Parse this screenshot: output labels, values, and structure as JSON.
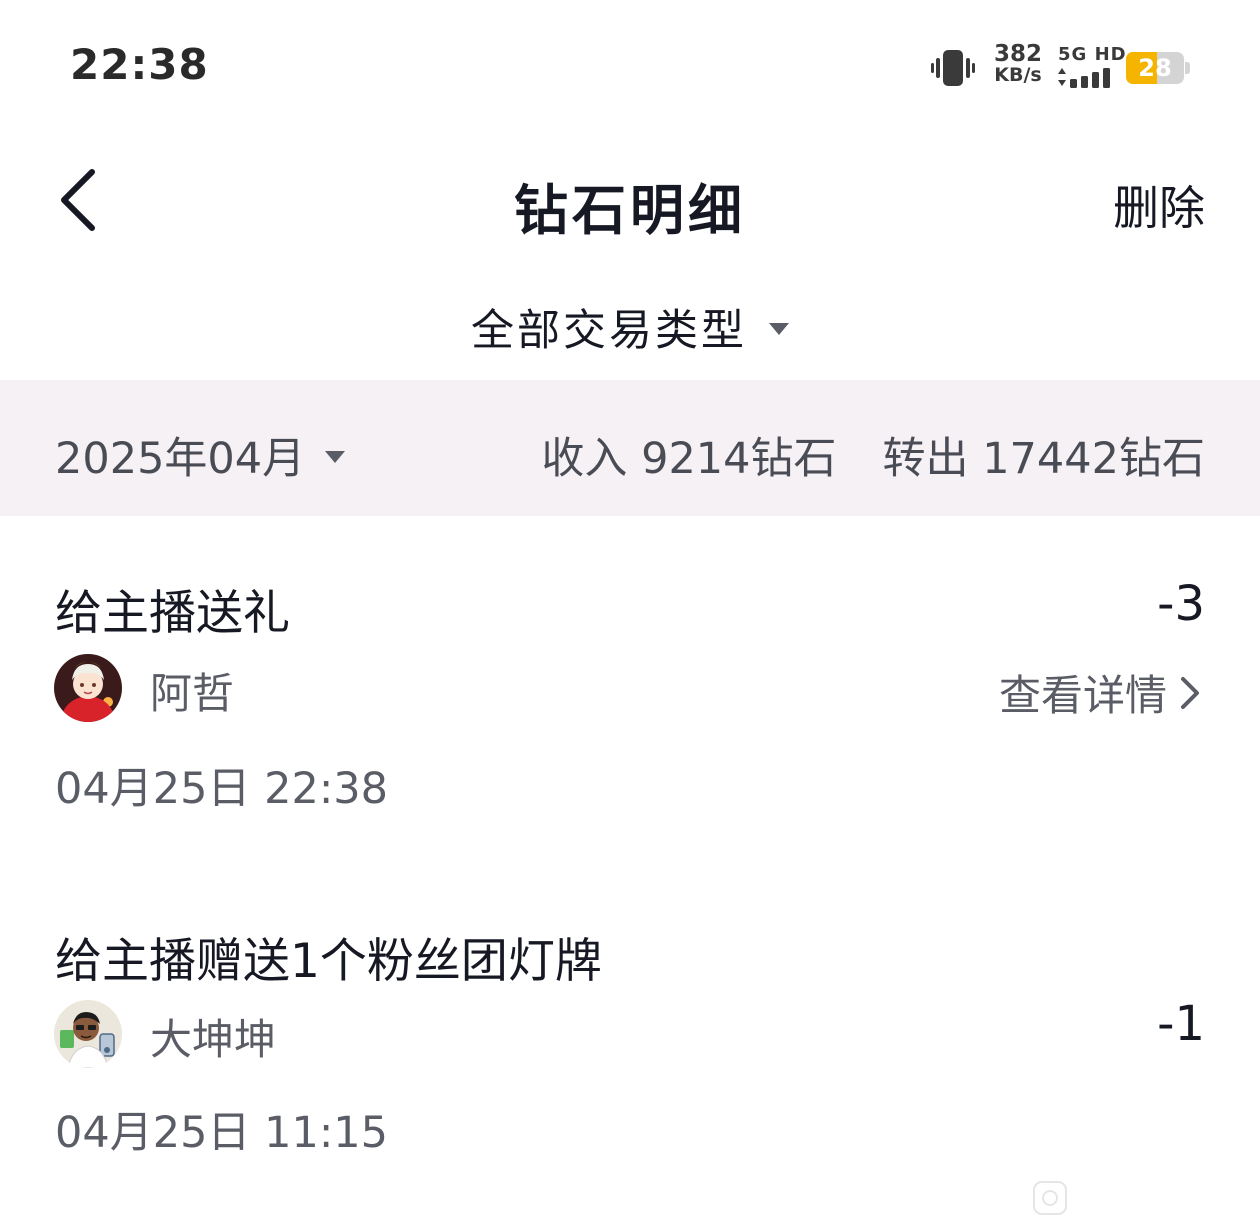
{
  "status_bar": {
    "time": "22:38",
    "net_speed_value": "382",
    "net_speed_unit": "KB/s",
    "network_type": "5G HD",
    "battery_level": "28",
    "battery_fraction": 0.28,
    "icons": [
      "vibrate-icon",
      "signal-icon",
      "battery-icon"
    ]
  },
  "nav": {
    "title": "钻石明细",
    "delete_label": "删除",
    "back_icon": "chevron-left-icon"
  },
  "filter": {
    "type_label": "全部交易类型"
  },
  "month_bar": {
    "month_label": "2025年04月",
    "income_text": "收入 9214钻石",
    "outgo_text": "转出 17442钻石"
  },
  "records": [
    {
      "title": "给主播送礼",
      "amount": "-3",
      "user_name": "阿哲",
      "details_label": "查看详情",
      "time": "04月25日 22:38"
    },
    {
      "title": "给主播赠送1个粉丝团灯牌",
      "amount": "-1",
      "user_name": "大坤坤",
      "time": "04月25日 11:15"
    }
  ],
  "colors": {
    "primary_text": "#161823",
    "secondary_text": "#5a5c66",
    "summary_bg": "#f5f1f4",
    "battery_accent": "#f5b400"
  }
}
